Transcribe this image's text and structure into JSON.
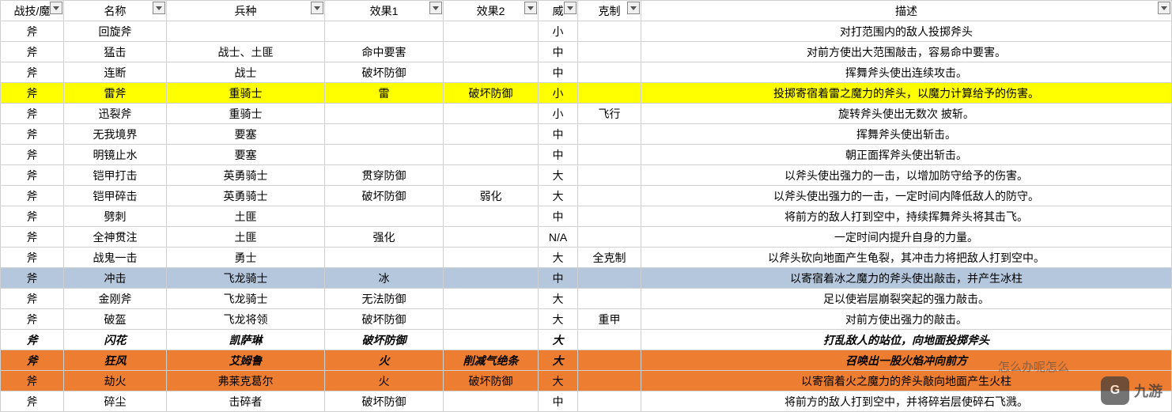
{
  "headers": [
    "战技/魔",
    "名称",
    "兵种",
    "效果1",
    "效果2",
    "威",
    "克制",
    "描述"
  ],
  "rows": [
    {
      "cls": "",
      "c": [
        "斧",
        "回旋斧",
        "",
        "",
        "",
        "小",
        "",
        "对打范围内的敌人投掷斧头"
      ]
    },
    {
      "cls": "",
      "c": [
        "斧",
        "猛击",
        "战士、土匪",
        "命中要害",
        "",
        "中",
        "",
        "对前方使出大范围敲击，容易命中要害。"
      ]
    },
    {
      "cls": "",
      "c": [
        "斧",
        "连断",
        "战士",
        "破坏防御",
        "",
        "中",
        "",
        "挥舞斧头使出连续攻击。"
      ]
    },
    {
      "cls": "row-yellow",
      "c": [
        "斧",
        "雷斧",
        "重骑士",
        "雷",
        "破坏防御",
        "小",
        "",
        "投掷寄宿着雷之魔力的斧头，以魔力计算给予的伤害。"
      ]
    },
    {
      "cls": "",
      "c": [
        "斧",
        "迅裂斧",
        "重骑士",
        "",
        "",
        "小",
        "飞行",
        "旋转斧头使出无数次 披斩。"
      ]
    },
    {
      "cls": "",
      "c": [
        "斧",
        "无我境界",
        "要塞",
        "",
        "",
        "中",
        "",
        "挥舞斧头使出斩击。"
      ]
    },
    {
      "cls": "",
      "c": [
        "斧",
        "明镜止水",
        "要塞",
        "",
        "",
        "中",
        "",
        "朝正面挥斧头使出斩击。"
      ]
    },
    {
      "cls": "",
      "c": [
        "斧",
        "铠甲打击",
        "英勇骑士",
        "贯穿防御",
        "",
        "大",
        "",
        "以斧头使出强力的一击，以增加防守给予的伤害。"
      ]
    },
    {
      "cls": "",
      "c": [
        "斧",
        "铠甲碎击",
        "英勇骑士",
        "破坏防御",
        "弱化",
        "大",
        "",
        "以斧头使出强力的一击，一定时间内降低敌人的防守。"
      ]
    },
    {
      "cls": "",
      "c": [
        "斧",
        "劈刺",
        "土匪",
        "",
        "",
        "中",
        "",
        "将前方的敌人打到空中，持续挥舞斧头将其击飞。"
      ]
    },
    {
      "cls": "",
      "c": [
        "斧",
        "全神贯注",
        "土匪",
        "强化",
        "",
        "N/A",
        "",
        "一定时间内提升自身的力量。"
      ]
    },
    {
      "cls": "",
      "c": [
        "斧",
        "战鬼一击",
        "勇士",
        "",
        "",
        "大",
        "全克制",
        "以斧头砍向地面产生龟裂，其冲击力将把敌人打到空中。"
      ]
    },
    {
      "cls": "row-blue",
      "c": [
        "斧",
        "冲击",
        "飞龙骑士",
        "冰",
        "",
        "中",
        "",
        "以寄宿着冰之魔力的斧头使出敲击，并产生冰柱"
      ]
    },
    {
      "cls": "",
      "c": [
        "斧",
        "金刚斧",
        "飞龙骑士",
        "无法防御",
        "",
        "大",
        "",
        "足以使岩层崩裂突起的强力敲击。"
      ]
    },
    {
      "cls": "",
      "c": [
        "斧",
        "破盔",
        "飞龙将领",
        "破坏防御",
        "",
        "大",
        "重甲",
        "对前方使出强力的敲击。"
      ]
    },
    {
      "cls": "bold",
      "c": [
        "斧",
        "闪花",
        "凯萨琳",
        "破坏防御",
        "",
        "大",
        "",
        "打乱敌人的站位，向地面投掷斧头"
      ]
    },
    {
      "cls": "row-orange bold",
      "c": [
        "斧",
        "狂风",
        "艾姆鲁",
        "火",
        "削减气绝条",
        "大",
        "",
        "召唤出一股火焰冲向前方"
      ]
    },
    {
      "cls": "row-orange",
      "c": [
        "斧",
        "劫火",
        "弗莱克葛尔",
        "火",
        "破坏防御",
        "大",
        "",
        "以寄宿着火之魔力的斧头敲向地面产生火柱"
      ]
    },
    {
      "cls": "",
      "c": [
        "斧",
        "碎尘",
        "击碎者",
        "破坏防御",
        "",
        "中",
        "",
        "将前方的敌人打到空中，并将碎岩层使碎石飞溅。"
      ]
    }
  ],
  "watermark": {
    "logo": "G",
    "text": "九游"
  },
  "overlay": "怎么办呢怎么"
}
